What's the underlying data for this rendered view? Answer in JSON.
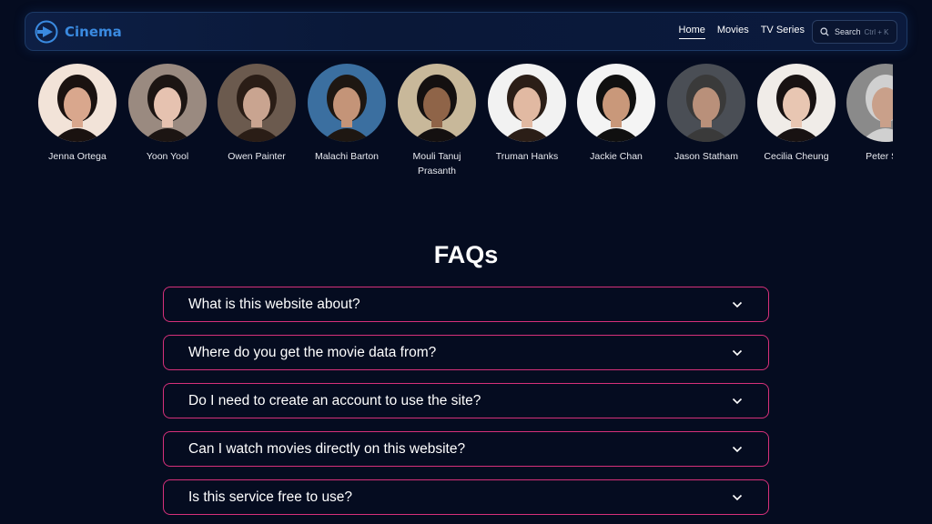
{
  "app": {
    "name": "Cinema"
  },
  "nav": {
    "items": [
      {
        "label": "Home",
        "active": true
      },
      {
        "label": "Movies",
        "active": false
      },
      {
        "label": "TV Series",
        "active": false
      }
    ]
  },
  "search": {
    "label": "Search",
    "shortcut": "Ctrl + K",
    "icon": "search-icon"
  },
  "cast": [
    {
      "name": "Jenna Ortega",
      "skin": "#d9a78d",
      "hair": "#1a1210",
      "bg": "#f2e3d8"
    },
    {
      "name": "Yoon Yool",
      "skin": "#e6c2b0",
      "hair": "#1c1513",
      "bg": "#9a8a80"
    },
    {
      "name": "Owen Painter",
      "skin": "#c9a490",
      "hair": "#2a1d16",
      "bg": "#6b5a4e"
    },
    {
      "name": "Malachi Barton",
      "skin": "#c49478",
      "hair": "#1e1712",
      "bg": "#3b6fa0"
    },
    {
      "name": "Mouli Tanuj Prasanth",
      "skin": "#8f6448",
      "hair": "#141010",
      "bg": "#c8b89a"
    },
    {
      "name": "Truman Hanks",
      "skin": "#e1b9a2",
      "hair": "#2b1e17",
      "bg": "#f2f2f2"
    },
    {
      "name": "Jackie Chan",
      "skin": "#c9987a",
      "hair": "#101010",
      "bg": "#f4f4f4"
    },
    {
      "name": "Jason Statham",
      "skin": "#b9907a",
      "hair": "#3a3a3a",
      "bg": "#4a4e55"
    },
    {
      "name": "Cecilia Cheung",
      "skin": "#e8c6b2",
      "hair": "#181212",
      "bg": "#f0ece8"
    },
    {
      "name": "Peter Sto",
      "skin": "#c9a08a",
      "hair": "#d0d0d0",
      "bg": "#8a8a8a"
    }
  ],
  "faq": {
    "title": "FAQs",
    "items": [
      {
        "question": "What is this website about?"
      },
      {
        "question": "Where do you get the movie data from?"
      },
      {
        "question": "Do I need to create an account to use the site?"
      },
      {
        "question": "Can I watch movies directly on this website?"
      },
      {
        "question": "Is this service free to use?"
      }
    ]
  },
  "colors": {
    "background": "#050c20",
    "accent": "#3a8ae0",
    "faq_border": "#d6307a"
  }
}
